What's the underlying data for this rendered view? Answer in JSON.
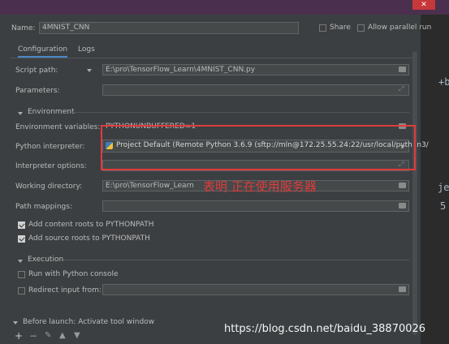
{
  "window": {
    "close_glyph": "✕"
  },
  "header": {
    "name_label": "Name:",
    "name_value": "4MNIST_CNN",
    "share_label": "Share",
    "parallel_label": "Allow parallel run"
  },
  "tabs": [
    {
      "label": "Configuration"
    },
    {
      "label": "Logs"
    }
  ],
  "form": {
    "script_path_label": "Script path:",
    "script_path_value": "E:\\pro\\TensorFlow_Learn\\4MNIST_CNN.py",
    "parameters_label": "Parameters:",
    "environment_section": "Environment",
    "env_vars_label": "Environment variables:",
    "env_vars_value": "PYTHONUNBUFFERED=1",
    "interpreter_label": "Python interpreter:",
    "interpreter_value": "Project Default (Remote Python 3.6.9 (sftp://mln@172.25.55.24:22/usr/local/python3/",
    "interpreter_options_label": "Interpreter options:",
    "working_dir_label": "Working directory:",
    "working_dir_value": "E:\\pro\\TensorFlow_Learn",
    "path_mappings_label": "Path mappings:",
    "add_content_roots_label": "Add content roots to PYTHONPATH",
    "add_source_roots_label": "Add source roots to PYTHONPATH",
    "execution_section": "Execution",
    "python_console_label": "Run with Python console",
    "redirect_input_label": "Redirect input from:",
    "before_launch_label": "Before launch: Activate tool window"
  },
  "annotation": "表明  正在使用服务器",
  "watermark": "https://blog.csdn.net/baidu_38870026",
  "side_code": [
    "+b",
    "je",
    "5"
  ],
  "colors": {
    "accent": "#4a88c7",
    "annotation_red": "#e03b3b"
  }
}
